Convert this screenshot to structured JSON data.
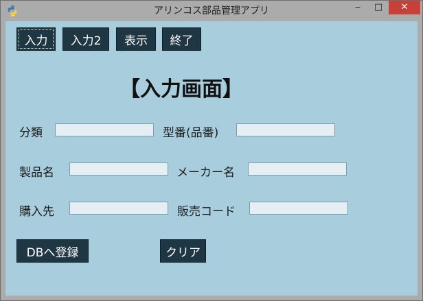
{
  "window": {
    "title": "アリンコス部品管理アプリ",
    "minimize_glyph": "‒",
    "maximize_glyph": "□",
    "close_glyph": "✕"
  },
  "icons": {
    "app": "python-icon"
  },
  "colors": {
    "client_bg": "#a8cddd",
    "button_bg": "#1f3743",
    "button_text": "#ffffff",
    "close_bg": "#c7413a"
  },
  "nav": {
    "input": "入力",
    "input2": "入力2",
    "display": "表示",
    "exit": "終了"
  },
  "heading": "【入力画面】",
  "form": {
    "category": {
      "label": "分類",
      "value": ""
    },
    "model_number": {
      "label": "型番(品番)",
      "value": ""
    },
    "product_name": {
      "label": "製品名",
      "value": ""
    },
    "manufacturer": {
      "label": "メーカー名",
      "value": ""
    },
    "supplier": {
      "label": "購入先",
      "value": ""
    },
    "sales_code": {
      "label": "販売コード",
      "value": ""
    }
  },
  "actions": {
    "register": "DBへ登録",
    "clear": "クリア"
  }
}
